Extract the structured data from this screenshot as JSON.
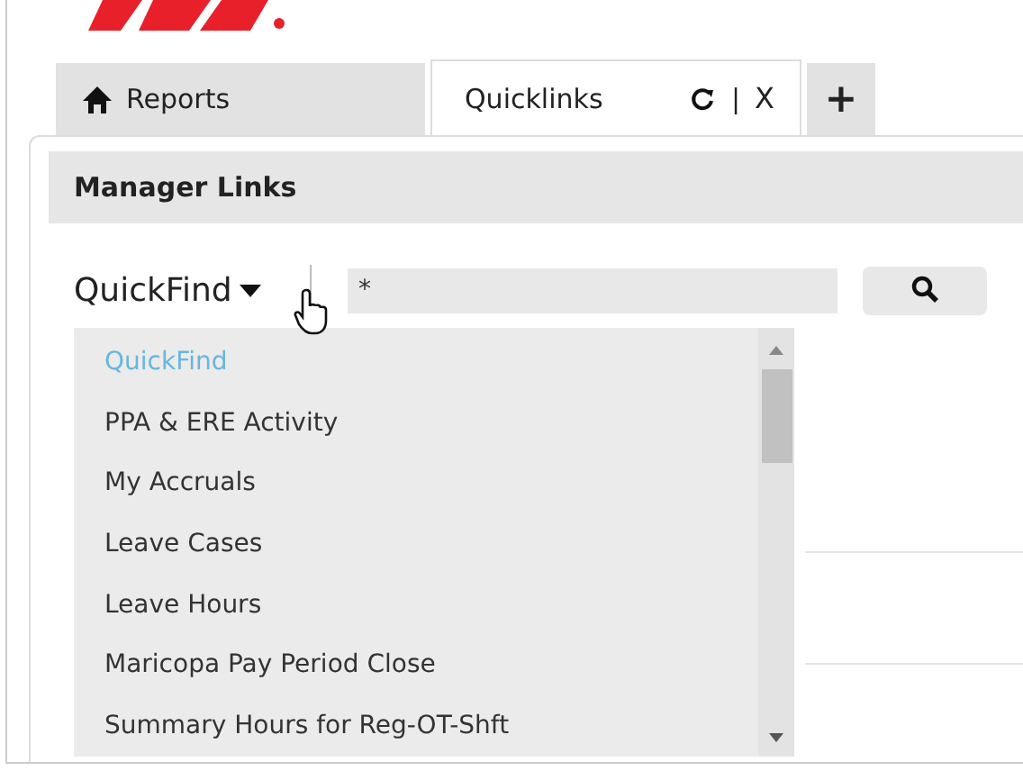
{
  "tabs": [
    {
      "kind": "home",
      "label": "Reports",
      "selected": false
    },
    {
      "kind": "closable",
      "label": "Quicklinks",
      "selected": true,
      "separator": "|",
      "close": "X"
    },
    {
      "kind": "add",
      "label": "+",
      "selected": false
    }
  ],
  "panel": {
    "title": "Manager Links"
  },
  "quickfind": {
    "label": "QuickFind",
    "value": "*",
    "expanded": true
  },
  "options": [
    {
      "label": "QuickFind",
      "selected": true
    },
    {
      "label": "PPA & ERE Activity",
      "selected": false
    },
    {
      "label": "My Accruals",
      "selected": false
    },
    {
      "label": "Leave Cases",
      "selected": false
    },
    {
      "label": "Leave Hours",
      "selected": false
    },
    {
      "label": "Maricopa Pay Period Close",
      "selected": false
    },
    {
      "label": "Summary Hours for Reg-OT-Shft",
      "selected": false
    }
  ]
}
